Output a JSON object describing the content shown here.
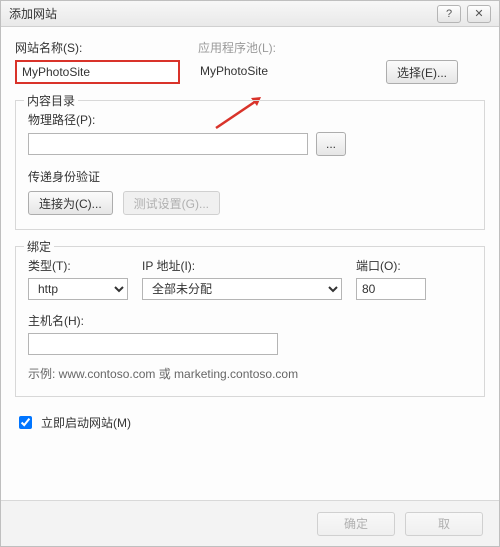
{
  "window": {
    "title": "添加网站"
  },
  "titlebar": {
    "help": "?",
    "close": "✕"
  },
  "site": {
    "name_label": "网站名称(S):",
    "name_value": "MyPhotoSite",
    "pool_label": "应用程序池(L):",
    "pool_value": "MyPhotoSite",
    "select_btn": "选择(E)..."
  },
  "content_dir": {
    "legend": "内容目录",
    "physical_path_label": "物理路径(P):",
    "physical_path_value": "",
    "browse_btn": "...",
    "auth_label": "传递身份验证",
    "connect_as_btn": "连接为(C)...",
    "test_settings_btn": "测试设置(G)..."
  },
  "binding": {
    "legend": "绑定",
    "type_label": "类型(T):",
    "type_value": "http",
    "ip_label": "IP 地址(I):",
    "ip_value": "全部未分配",
    "port_label": "端口(O):",
    "port_value": "80",
    "hostname_label": "主机名(H):",
    "hostname_value": "",
    "example_text": "示例: www.contoso.com 或 marketing.contoso.com"
  },
  "start_site": {
    "label": "立即启动网站(M)",
    "checked": true
  },
  "footer": {
    "ok": "确定",
    "cancel": "取"
  }
}
